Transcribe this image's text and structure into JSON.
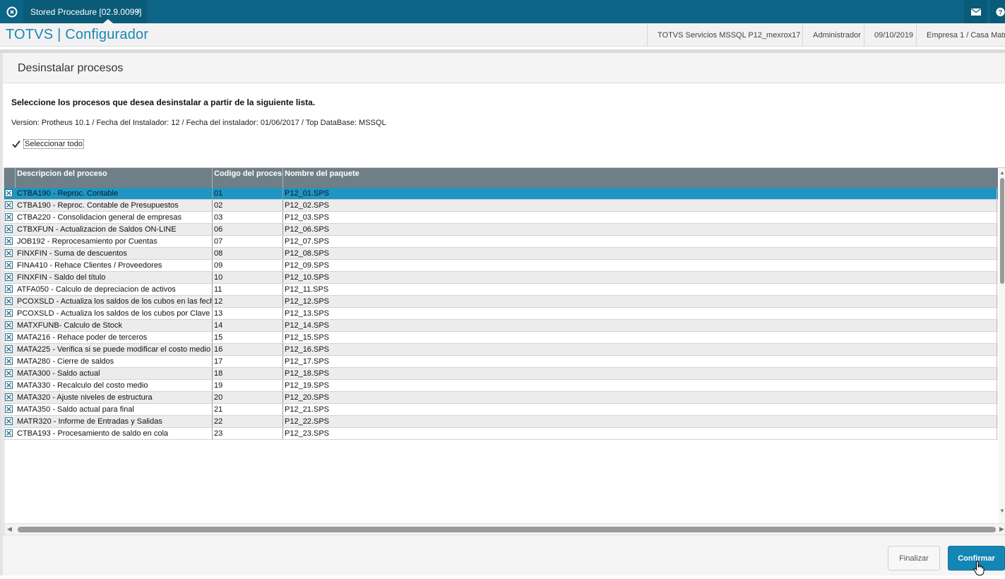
{
  "topbar": {
    "tab_label": "Stored Procedure [02.9.0099]",
    "tab_close": "×",
    "app_icon": "totvs-logo-icon",
    "mail_icon": "mail-icon",
    "help_icon": "help-icon",
    "bar_color": "#0c6586"
  },
  "header": {
    "brand": "TOTVS | Configurador",
    "environment": "TOTVS Servicios MSSQL P12_mexrox17",
    "user": "Administrador",
    "date": "09/10/2019",
    "company": "Empresa 1 / Casa Matriz",
    "brand_color": "#1b87b5"
  },
  "panel": {
    "title": "Desinstalar procesos",
    "instruction": "Seleccione los procesos que desea desinstalar a partir de la siguiente lista.",
    "version_info": "Version: Protheus 10.1 / Fecha del Instalador: 12 / Fecha del instalador: 01/06/2017 / Top DataBase: MSSQL",
    "select_all_label": "Seleccionar todo",
    "select_all_checked": true
  },
  "grid": {
    "columns": [
      "Descripcion del proceso",
      "Codigo del proceso",
      "Nombre del paquete"
    ],
    "selected_row": 0,
    "rows": [
      {
        "desc": "CTBA190 - Reproc. Contable",
        "code": "01",
        "pkg": "P12_01.SPS"
      },
      {
        "desc": "CTBA190 - Reproc. Contable de Presupuestos",
        "code": "02",
        "pkg": "P12_02.SPS"
      },
      {
        "desc": "CTBA220 - Consolidacion general de empresas",
        "code": "03",
        "pkg": "P12_03.SPS"
      },
      {
        "desc": "CTBXFUN - Actualizacion de Saldos ON-LINE",
        "code": "06",
        "pkg": "P12_06.SPS"
      },
      {
        "desc": "JOB192 - Reprocesamiento por Cuentas",
        "code": "07",
        "pkg": "P12_07.SPS"
      },
      {
        "desc": "FINXFIN - Suma de descuentos",
        "code": "08",
        "pkg": "P12_08.SPS"
      },
      {
        "desc": "FINA410 - Rehace Clientes / Proveedores",
        "code": "09",
        "pkg": "P12_09.SPS"
      },
      {
        "desc": "FINXFIN - Saldo del título",
        "code": "10",
        "pkg": "P12_10.SPS"
      },
      {
        "desc": "ATFA050 - Calculo de depreciacion de activos",
        "code": "11",
        "pkg": "P12_11.SPS"
      },
      {
        "desc": "PCOXSLD - Actualiza los saldos de los cubos en las fech",
        "code": "12",
        "pkg": "P12_12.SPS"
      },
      {
        "desc": "PCOXSLD - Actualiza los saldos de los cubos por Clave",
        "code": "13",
        "pkg": "P12_13.SPS"
      },
      {
        "desc": "MATXFUNB- Calculo de Stock",
        "code": "14",
        "pkg": "P12_14.SPS"
      },
      {
        "desc": "MATA216 - Rehace poder de terceros",
        "code": "15",
        "pkg": "P12_15.SPS"
      },
      {
        "desc": "MATA225 - Verifica si se puede modificar el costo medio",
        "code": "16",
        "pkg": "P12_16.SPS"
      },
      {
        "desc": "MATA280 - Cierre de saldos",
        "code": "17",
        "pkg": "P12_17.SPS"
      },
      {
        "desc": "MATA300 - Saldo actual",
        "code": "18",
        "pkg": "P12_18.SPS"
      },
      {
        "desc": "MATA330 - Recalculo del costo medio",
        "code": "19",
        "pkg": "P12_19.SPS"
      },
      {
        "desc": "MATA320 - Ajuste niveles de estructura",
        "code": "20",
        "pkg": "P12_20.SPS"
      },
      {
        "desc": "MATA350 - Saldo actual para final",
        "code": "21",
        "pkg": "P12_21.SPS"
      },
      {
        "desc": "MATR320 - Informe de Entradas y Salidas",
        "code": "22",
        "pkg": "P12_22.SPS"
      },
      {
        "desc": "CTBA193 - Procesamiento de saldo en cola",
        "code": "23",
        "pkg": "P12_23.SPS"
      }
    ],
    "header_color": "#6f7f87",
    "selected_color": "#1f95c2"
  },
  "footer": {
    "finish_label": "Finalizar",
    "confirm_label": "Confirmar",
    "confirm_color": "#1386b4"
  }
}
